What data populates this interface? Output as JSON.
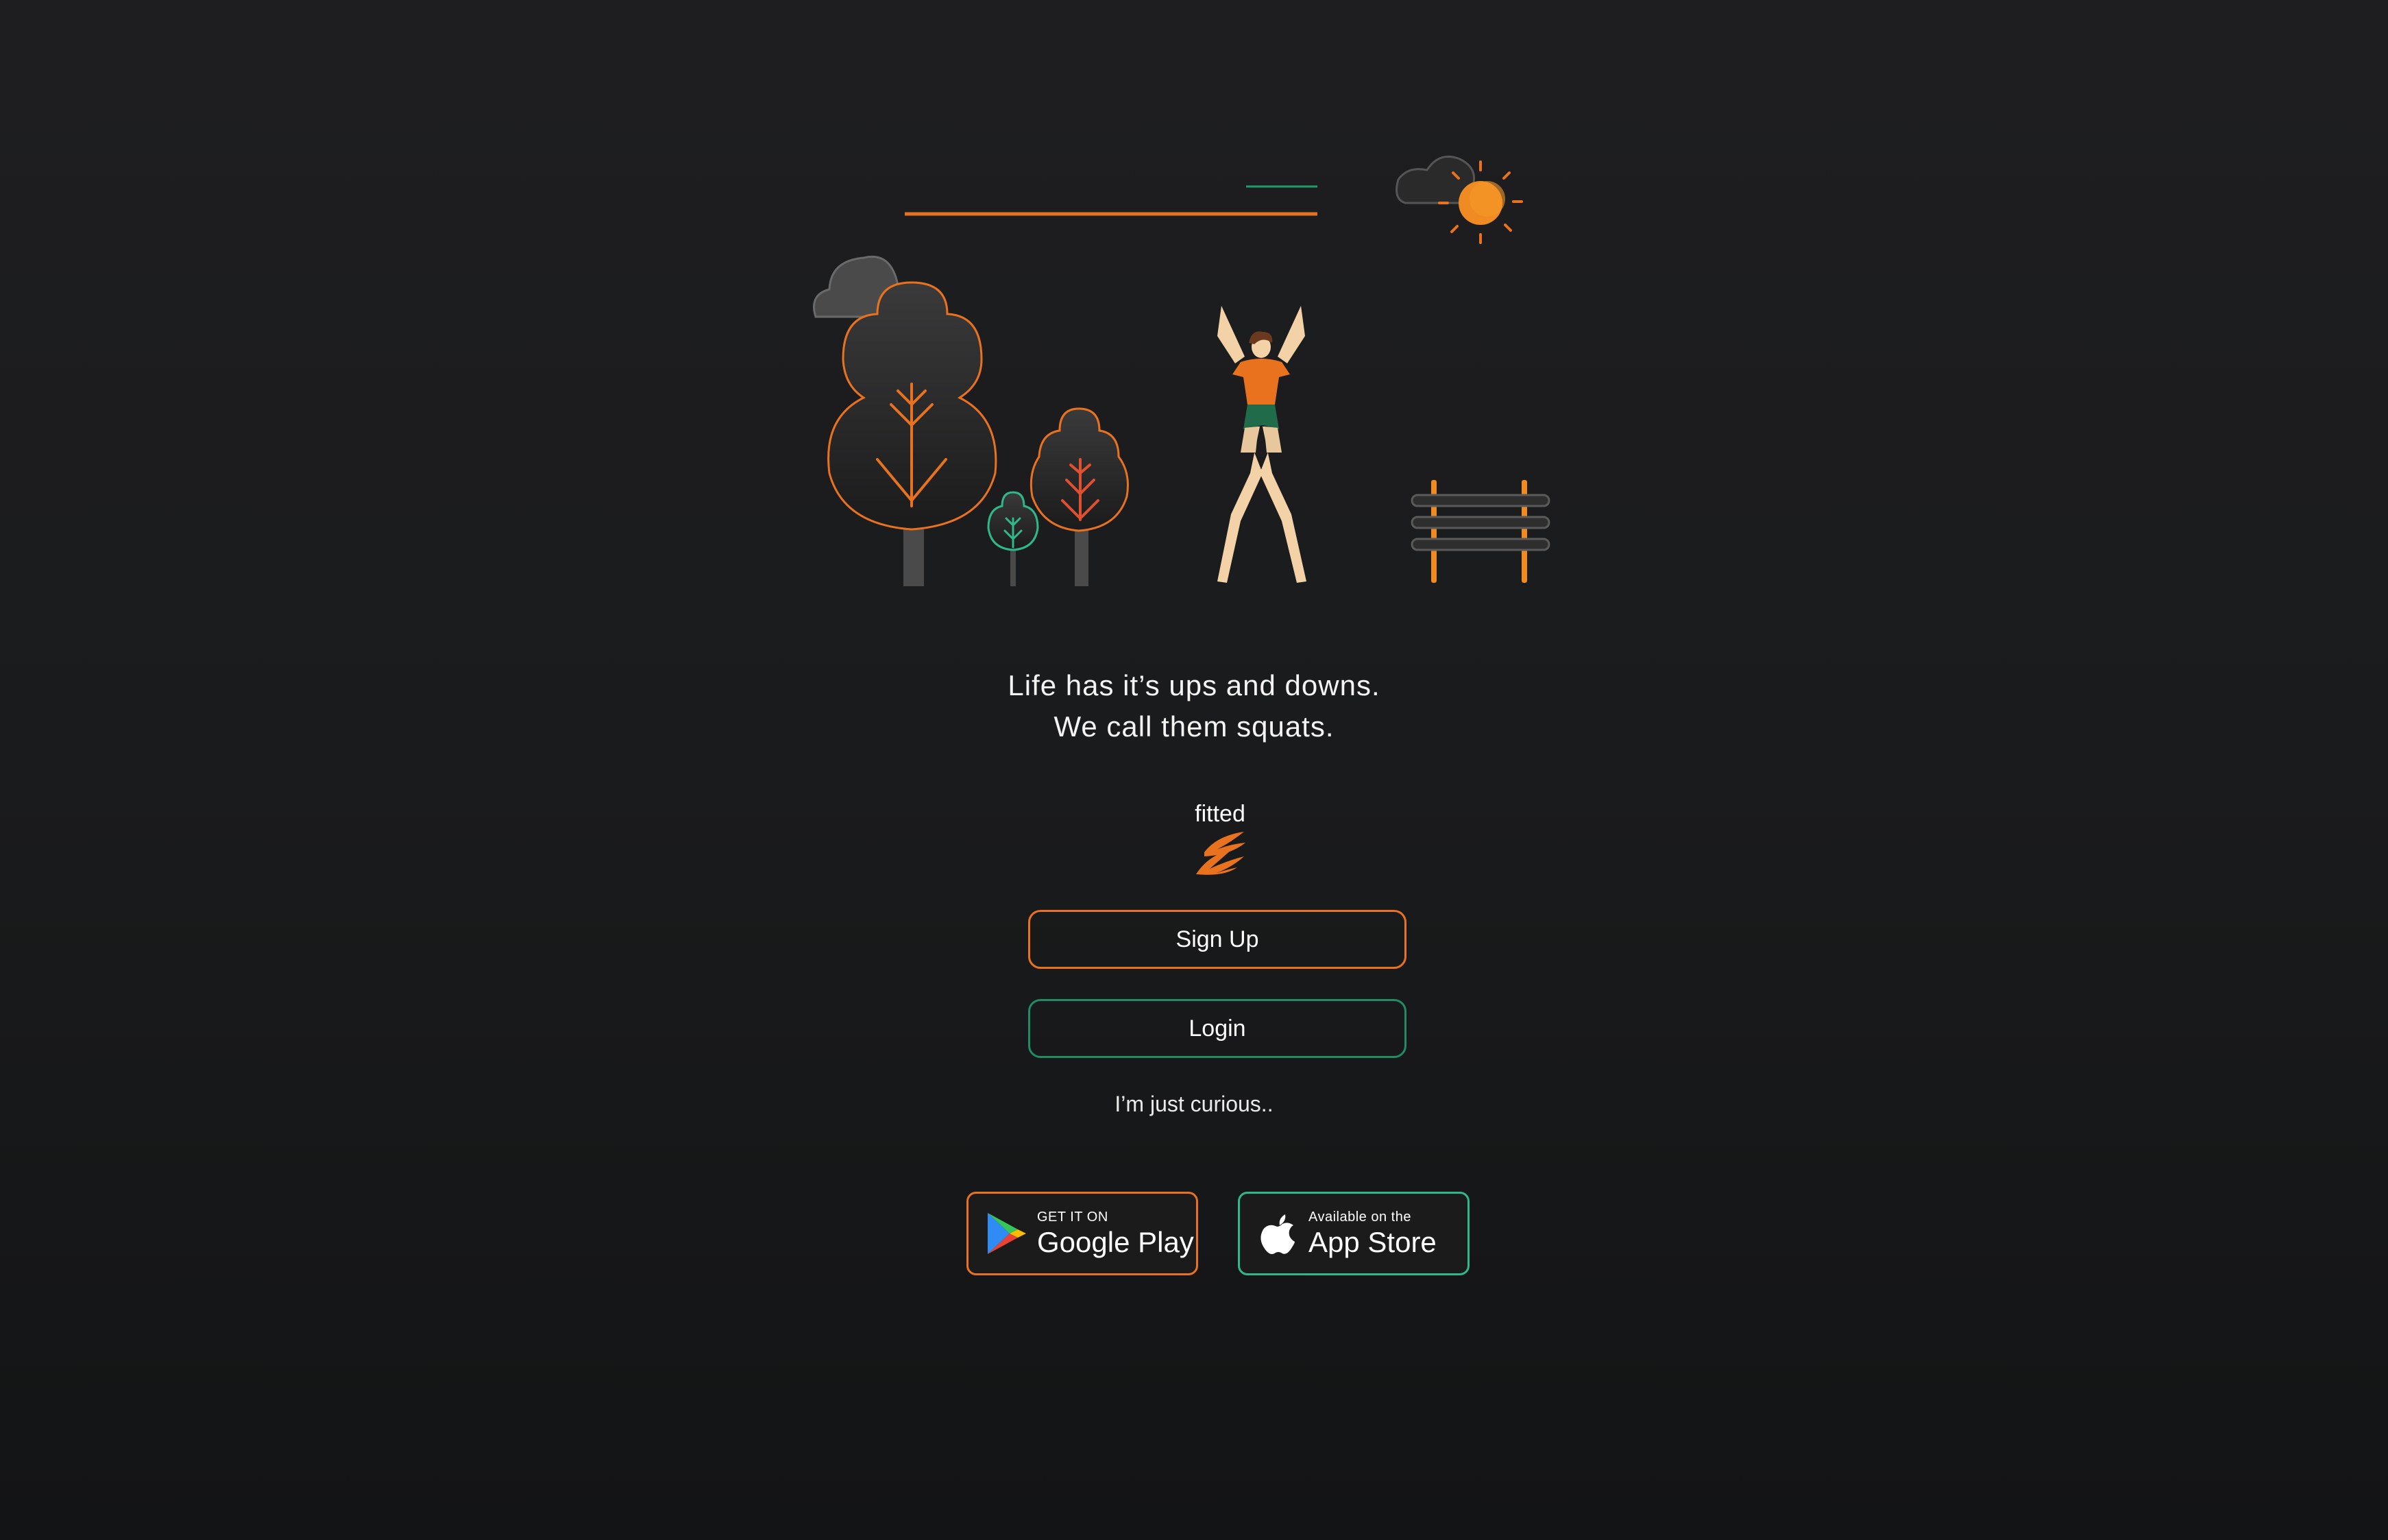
{
  "tagline": {
    "line1": "Life has it’s ups and downs.",
    "line2": "We call them squats."
  },
  "brand": {
    "name": "fitted"
  },
  "buttons": {
    "signup": "Sign Up",
    "login": "Login"
  },
  "curious_link": "I’m just curious..",
  "stores": {
    "google": {
      "small": "GET IT ON",
      "big": "Google Play"
    },
    "apple": {
      "small": "Available on the",
      "big": "App Store"
    }
  },
  "colors": {
    "accent_orange": "#e9721f",
    "accent_green": "#1f8c63",
    "background": "#1c1c1e"
  }
}
